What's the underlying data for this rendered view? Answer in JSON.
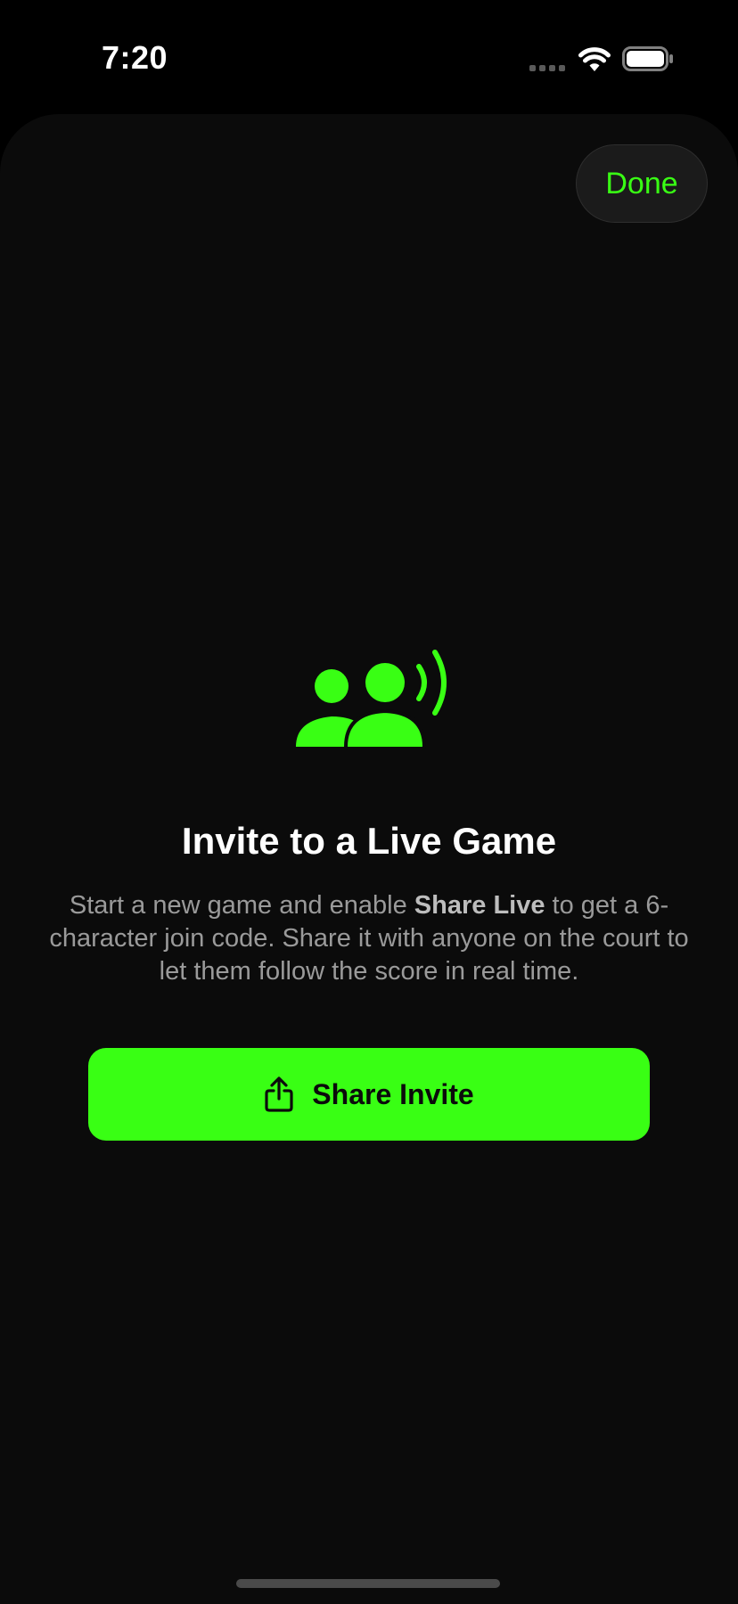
{
  "status_bar": {
    "time": "7:20"
  },
  "sheet": {
    "done_label": "Done",
    "title": "Invite to a Live Game",
    "description_before": "Start a new game and enable ",
    "description_bold": "Share Live",
    "description_after": " to get a 6-character join code. Share it with anyone on the court to let them follow the score in real time.",
    "share_button_label": "Share Invite"
  },
  "icons": {
    "hero": "people-broadcast-icon",
    "share": "share-icon",
    "wifi": "wifi-icon",
    "cell": "cellular-signal-icon",
    "battery": "battery-icon"
  },
  "colors": {
    "accent": "#39ff14",
    "background": "#000000",
    "sheet_background": "#0b0b0b",
    "muted_text": "#9a9a9a"
  }
}
